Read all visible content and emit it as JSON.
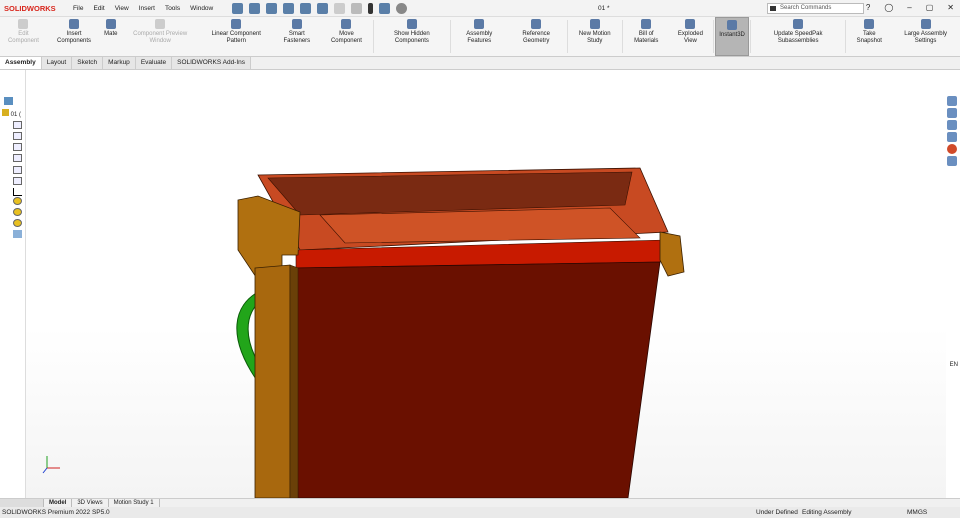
{
  "app": {
    "logo": "SOLIDWORKS",
    "doc_title": "01 *"
  },
  "menu": [
    "File",
    "Edit",
    "View",
    "Insert",
    "Tools",
    "Window"
  ],
  "search": {
    "placeholder": "Search Commands"
  },
  "ribbon": [
    {
      "label": "Edit Component",
      "disabled": true
    },
    {
      "label": "Insert Components"
    },
    {
      "label": "Mate"
    },
    {
      "label": "Component Preview Window",
      "disabled": true
    },
    {
      "label": "Linear Component Pattern"
    },
    {
      "label": "Smart Fasteners"
    },
    {
      "label": "Move Component"
    },
    {
      "label": "Show Hidden Components"
    },
    {
      "label": "Assembly Features"
    },
    {
      "label": "Reference Geometry"
    },
    {
      "label": "New Motion Study"
    },
    {
      "label": "Bill of Materials"
    },
    {
      "label": "Exploded View"
    },
    {
      "label": "Instant3D",
      "active": true
    },
    {
      "label": "Update SpeedPak Subassemblies"
    },
    {
      "label": "Take Snapshot"
    },
    {
      "label": "Large Assembly Settings"
    }
  ],
  "tabs": [
    "Assembly",
    "Layout",
    "Sketch",
    "Markup",
    "Evaluate",
    "SOLIDWORKS Add-Ins"
  ],
  "tree": {
    "root": "01 ("
  },
  "bottom_tabs": [
    "Model",
    "3D Views",
    "Motion Study 1"
  ],
  "status": {
    "product": "SOLIDWORKS Premium 2022 SP5.0",
    "state": "Under Defined",
    "mode": "Editing Assembly",
    "units": "MMGS"
  },
  "lang": "EN"
}
